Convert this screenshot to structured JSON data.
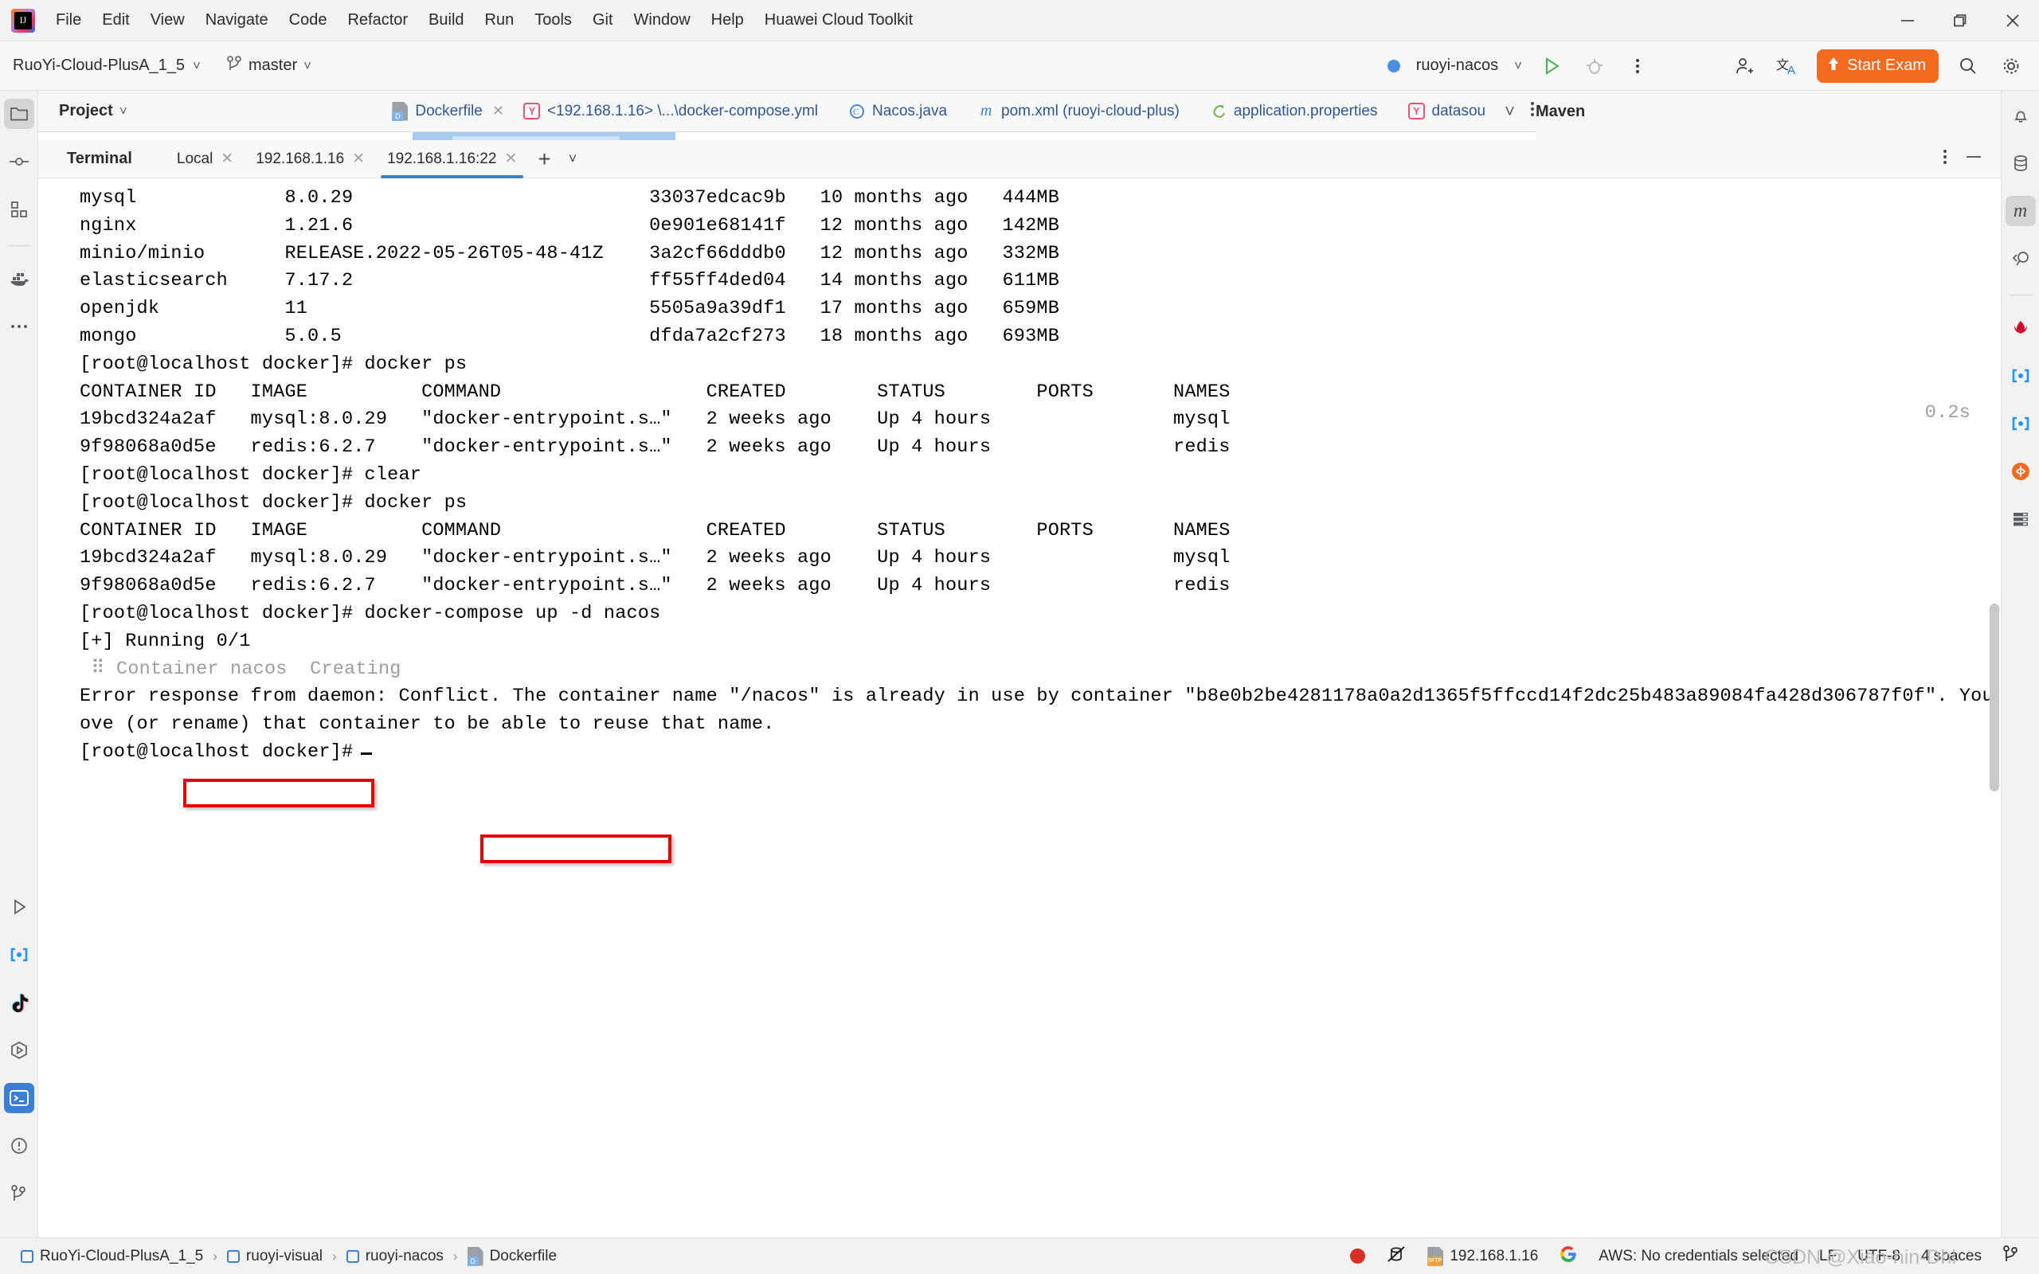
{
  "window": {
    "menu": [
      "File",
      "Edit",
      "View",
      "Navigate",
      "Code",
      "Refactor",
      "Build",
      "Run",
      "Tools",
      "Git",
      "Window",
      "Help",
      "Huawei Cloud Toolkit"
    ],
    "minimize": "minimize-icon",
    "restore": "restore-icon",
    "close": "close-icon"
  },
  "navbar": {
    "project": "RuoYi-Cloud-PlusA_1_5",
    "branch": "master",
    "run_config": "ruoyi-nacos",
    "run_label": "run-icon",
    "debug_label": "debug-icon",
    "more_label": "more-icon",
    "start_exam": "Start Exam"
  },
  "project_panel": {
    "title": "Project"
  },
  "editor_tabs": [
    {
      "label": "Dockerfile",
      "icon": "dockerfile-icon",
      "active": true,
      "closable": true
    },
    {
      "label": "<192.168.1.16> \\...\\docker-compose.yml",
      "icon": "yaml-icon",
      "active": false,
      "closable": false
    },
    {
      "label": "Nacos.java",
      "icon": "java-class-icon",
      "active": false,
      "closable": false
    },
    {
      "label": "pom.xml (ruoyi-cloud-plus)",
      "icon": "maven-icon",
      "active": false,
      "closable": false
    },
    {
      "label": "application.properties",
      "icon": "spring-icon",
      "active": false,
      "closable": false
    },
    {
      "label": "datasou",
      "icon": "yaml-icon",
      "active": false,
      "closable": false
    }
  ],
  "maven_panel": {
    "title": "Maven"
  },
  "terminal": {
    "title": "Terminal",
    "tabs": [
      {
        "label": "Local",
        "active": false
      },
      {
        "label": "192.168.1.16",
        "active": false
      },
      {
        "label": "192.168.1.16:22",
        "active": true
      }
    ],
    "add_tab": "+",
    "tab_list": "chevron-down-icon",
    "options": "more-options-icon",
    "hide": "hide-icon",
    "lines": [
      {
        "text": "mysql             8.0.29                          33037edcac9b   10 months ago   444MB",
        "dim": false
      },
      {
        "text": "nginx             1.21.6                          0e901e68141f   12 months ago   142MB",
        "dim": false
      },
      {
        "text": "minio/minio       RELEASE.2022-05-26T05-48-41Z    3a2cf66dddb0   12 months ago   332MB",
        "dim": false
      },
      {
        "text": "elasticsearch     7.17.2                          ff55ff4ded04   14 months ago   611MB",
        "dim": false
      },
      {
        "text": "openjdk           11                              5505a9a39df1   17 months ago   659MB",
        "dim": false
      },
      {
        "text": "mongo             5.0.5                           dfda7a2cf273   18 months ago   693MB",
        "dim": false
      },
      {
        "text": "[root@localhost docker]# docker ps",
        "dim": false
      },
      {
        "text": "CONTAINER ID   IMAGE          COMMAND                  CREATED        STATUS        PORTS       NAMES",
        "dim": false
      },
      {
        "text": "19bcd324a2af   mysql:8.0.29   \"docker-entrypoint.s…\"   2 weeks ago    Up 4 hours                mysql",
        "dim": false
      },
      {
        "text": "9f98068a0d5e   redis:6.2.7    \"docker-entrypoint.s…\"   2 weeks ago    Up 4 hours                redis",
        "dim": false
      },
      {
        "text": "[root@localhost docker]# clear",
        "dim": false
      },
      {
        "text": "[root@localhost docker]# docker ps",
        "dim": false
      },
      {
        "text": "CONTAINER ID   IMAGE          COMMAND                  CREATED        STATUS        PORTS       NAMES",
        "dim": false
      },
      {
        "text": "19bcd324a2af   mysql:8.0.29   \"docker-entrypoint.s…\"   2 weeks ago    Up 4 hours                mysql",
        "dim": false
      },
      {
        "text": "9f98068a0d5e   redis:6.2.7    \"docker-entrypoint.s…\"   2 weeks ago    Up 4 hours                redis",
        "dim": false
      },
      {
        "text": "[root@localhost docker]# docker-compose up -d nacos",
        "dim": false
      },
      {
        "text": "[+] Running 0/1",
        "dim": false
      },
      {
        "text": " ⠿ Container nacos  Creating",
        "dim": true
      },
      {
        "text": "Error response from daemon: Conflict. The container name \"/nacos\" is already in use by container \"b8e0b2be4281178a0a2d1365f5ffccd14f2dc25b483a89084fa428d306787f0f\". You have to rem",
        "dim": false
      },
      {
        "text": "ove (or rename) that container to be able to reuse that name.",
        "dim": false
      },
      {
        "text": "[root@localhost docker]#",
        "dim": false
      }
    ],
    "spinner_time": "0.2s",
    "highlight_command": "docker-compose up -d nacos",
    "highlight_error": "already in use by container"
  },
  "statusbar": {
    "breadcrumbs": [
      "RuoYi-Cloud-PlusA_1_5",
      "ruoyi-visual",
      "ruoyi-nacos",
      "Dockerfile"
    ],
    "record_icon": "record-icon",
    "no-sync_icon": "db-disconnect-icon",
    "sftp_host": "192.168.1.16",
    "google_icon": "google-icon",
    "aws": "AWS: No credentials selected",
    "line_sep": "LF",
    "encoding": "UTF-8",
    "indent": "4 spaces",
    "branch_icon": "git-branch-icon",
    "watermark": "CSDN @Xiao-hin-Dhi"
  },
  "left_stripe": [
    "project-icon",
    "commit-icon",
    "structure-icon",
    "docker-icon",
    "more-icon"
  ],
  "left_stripe_bottom": [
    "run-icon",
    "services-icon",
    "tiktok-icon",
    "endpoints-icon",
    "terminal-icon",
    "problems-icon",
    "git-icon"
  ],
  "right_stripe": [
    "notifications-icon",
    "database-icon",
    "maven-icon",
    "search-everywhere-icon",
    "huawei-icon",
    "services-icon",
    "services2-icon",
    "ali-icon",
    "layers-icon"
  ],
  "colors": {
    "accent": "#3a7fd5",
    "orange": "#f26b21",
    "annotation": "#e60000"
  }
}
